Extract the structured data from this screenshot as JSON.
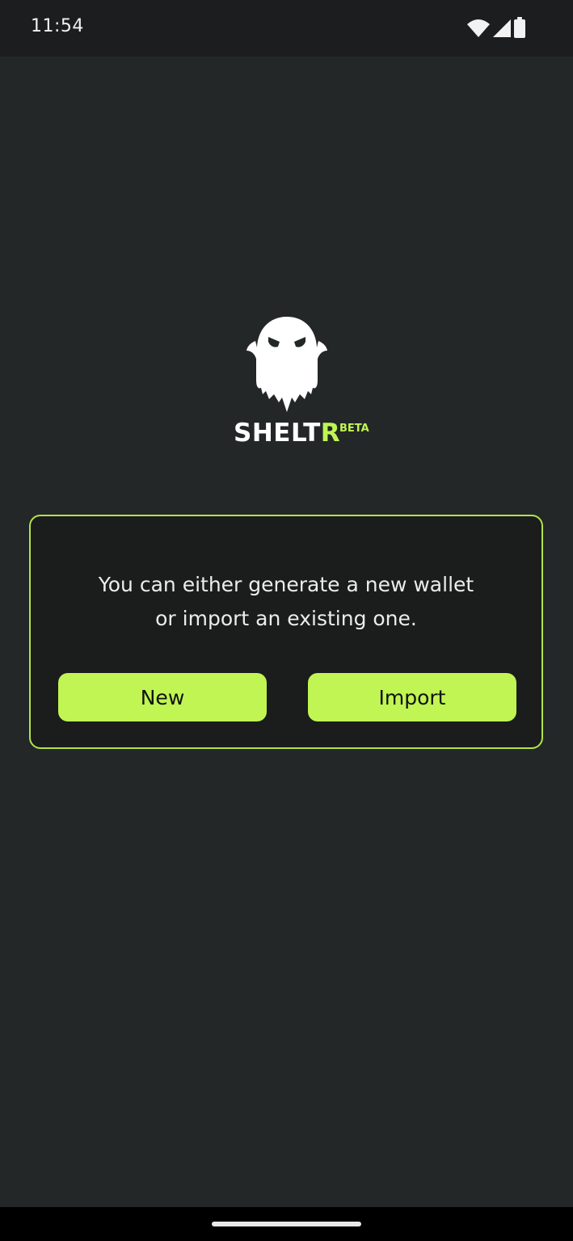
{
  "status_bar": {
    "time": "11:54",
    "icons": [
      "wifi-icon",
      "cellular-signal-icon",
      "battery-icon"
    ]
  },
  "logo": {
    "icon": "ghost-icon",
    "wordmark_main": "SHELT",
    "wordmark_accent": "R",
    "badge": "BETA"
  },
  "card": {
    "message_line1": "You can either generate a new wallet",
    "message_line2": "or import an existing one.",
    "new_button_label": "New",
    "import_button_label": "Import"
  },
  "theme": {
    "background": "#232728",
    "accent": "#c0f553",
    "card_background": "#1b1c1c"
  }
}
